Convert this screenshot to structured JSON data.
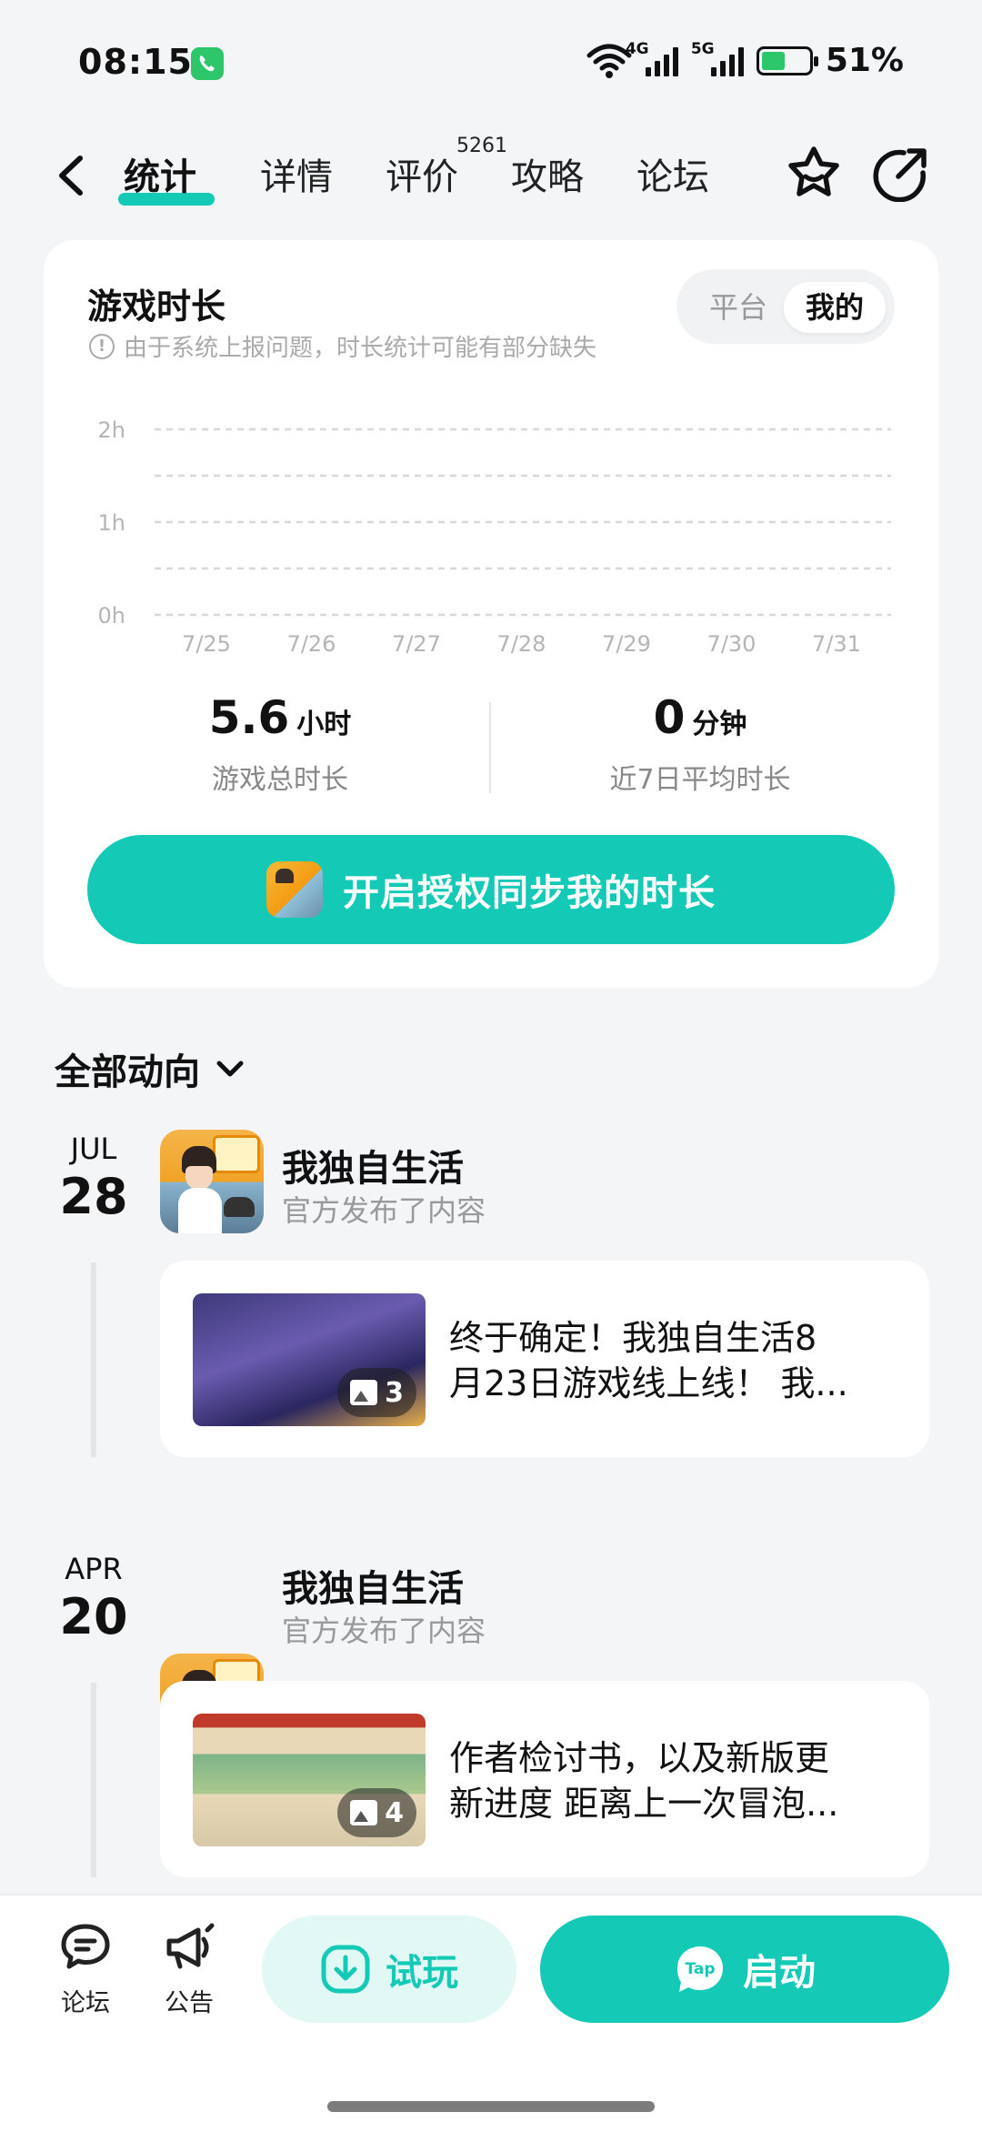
{
  "status_bar": {
    "time": "08:15",
    "network_1": "4G",
    "network_2": "5G",
    "battery": "51%",
    "battery_level": 0.51
  },
  "nav": {
    "tabs": [
      {
        "label": "统计",
        "active": true
      },
      {
        "label": "详情"
      },
      {
        "label": "评价",
        "badge": "5261"
      },
      {
        "label": "攻略"
      },
      {
        "label": "论坛"
      }
    ]
  },
  "playtime": {
    "title": "游戏时长",
    "note": "由于系统上报问题，时长统计可能有部分缺失",
    "segments": [
      "平台",
      "我的"
    ],
    "selected_segment": "我的",
    "chart_data": {
      "type": "bar",
      "categories": [
        "7/25",
        "7/26",
        "7/27",
        "7/28",
        "7/29",
        "7/30",
        "7/31"
      ],
      "values": [
        0,
        0,
        0,
        0,
        0,
        0,
        0
      ],
      "y_ticks": [
        "2h",
        "1h",
        "0h"
      ],
      "ylim": [
        0,
        2
      ],
      "grid": true
    },
    "total": {
      "value": "5.6",
      "unit": "小时",
      "label": "游戏总时长"
    },
    "average": {
      "value": "0",
      "unit": "分钟",
      "label": "近7日平均时长"
    },
    "auth_button": "开启授权同步我的时长"
  },
  "feed": {
    "header": "全部动向",
    "items": [
      {
        "month": "JUL",
        "day": "28",
        "author": "我独自生活",
        "action": "官方发布了内容",
        "title_line1": "终于确定！我独自生活8",
        "title_line2": "月23日游戏线上线！ 我...",
        "image_count": "3"
      },
      {
        "month": "APR",
        "day": "20",
        "author": "我独自生活",
        "action": "官方发布了内容",
        "title_line1": "作者检讨书，以及新版更",
        "title_line2": "新进度 距离上一次冒泡...",
        "image_count": "4"
      }
    ]
  },
  "bottom_bar": {
    "forum": "论坛",
    "notice": "公告",
    "trial": "试玩",
    "launch": "启动",
    "launch_badge": "Tap"
  },
  "colors": {
    "accent": "#15c9b7",
    "accent_light": "#e1f8f5",
    "background": "#f4f5f7"
  }
}
